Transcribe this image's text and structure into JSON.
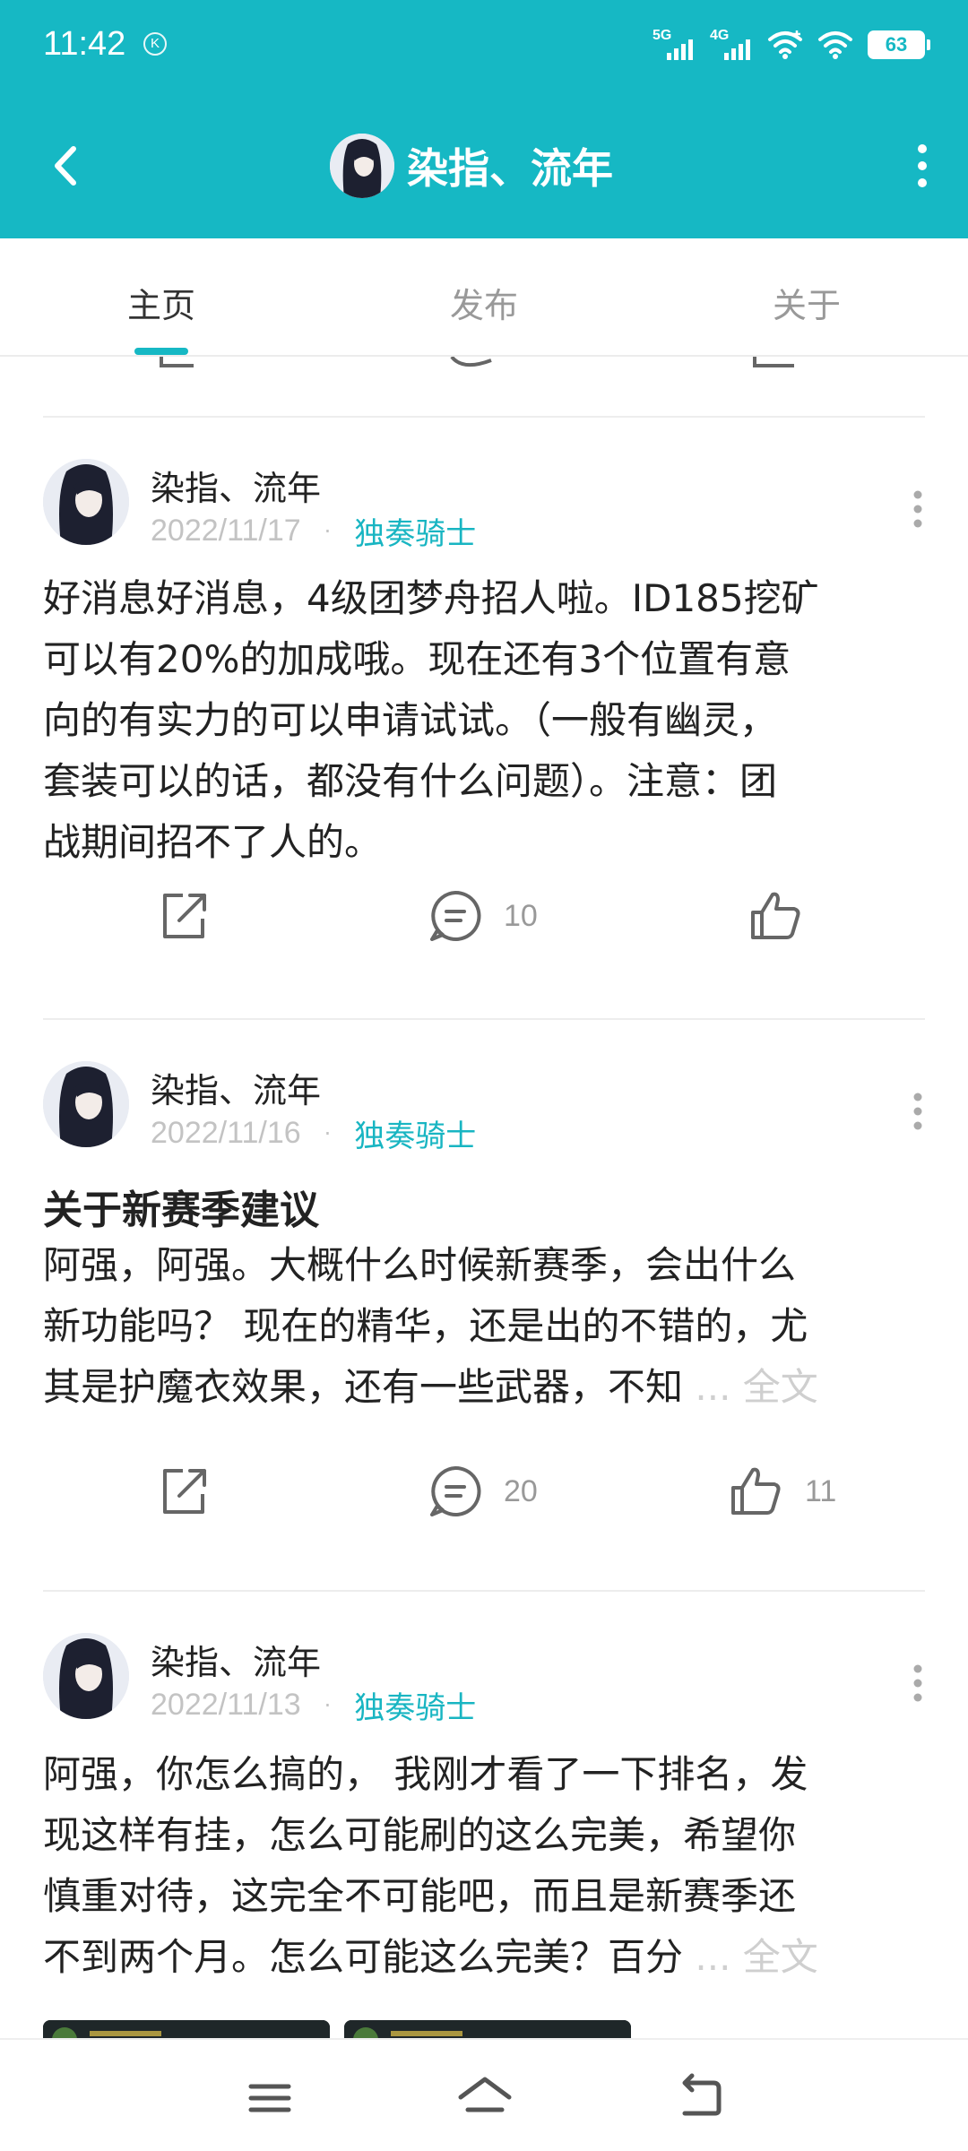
{
  "status_bar": {
    "time": "11:42",
    "k_badge": "K",
    "network1": "5G",
    "network2": "4G",
    "battery": "63"
  },
  "header": {
    "title": "染指、流年",
    "back_icon": "chevron-left-icon",
    "more_icon": "more-vertical-icon"
  },
  "tabs": [
    {
      "label": "主页",
      "active": true
    },
    {
      "label": "发布",
      "active": false
    },
    {
      "label": "关于",
      "active": false
    }
  ],
  "posts": [
    {
      "author": "染指、流年",
      "date": "2022/11/17",
      "separator": "·",
      "tag": "独奏骑士",
      "heading": "",
      "body_lines": [
        "好消息好消息，4级团梦舟招人啦。ID185挖矿",
        "可以有20%的加成哦。现在还有3个位置有意",
        "向的有实力的可以申请试试。（一般有幽灵，",
        "套装可以的话，都没有什么问题）。注意：团",
        "战期间招不了人的。"
      ],
      "comments": "10",
      "likes": ""
    },
    {
      "author": "染指、流年",
      "date": "2022/11/16",
      "separator": "·",
      "tag": "独奏骑士",
      "heading": "关于新赛季建议",
      "body_lines": [
        "阿强，阿强。大概什么时候新赛季，会出什么",
        "新功能吗？ 现在的精华，还是出的不错的，尤",
        "其是护魔衣效果，还有一些武器，不知"
      ],
      "ellipsis": "... ",
      "more_label": "全文",
      "comments": "20",
      "likes": "11"
    },
    {
      "author": "染指、流年",
      "date": "2022/11/13",
      "separator": "·",
      "tag": "独奏骑士",
      "heading": "",
      "body_lines": [
        "阿强，你怎么搞的， 我刚才看了一下排名，发",
        "现这样有挂，怎么可能刷的这么完美，希望你",
        "慎重对待，这完全不可能吧，而且是新赛季还",
        "不到两个月。怎么可能这么完美？百分"
      ],
      "ellipsis": "... ",
      "more_label": "全文"
    }
  ],
  "colors": {
    "accent": "#16b8c4",
    "tag": "#18b5c2",
    "muted": "#c3c3c3"
  }
}
